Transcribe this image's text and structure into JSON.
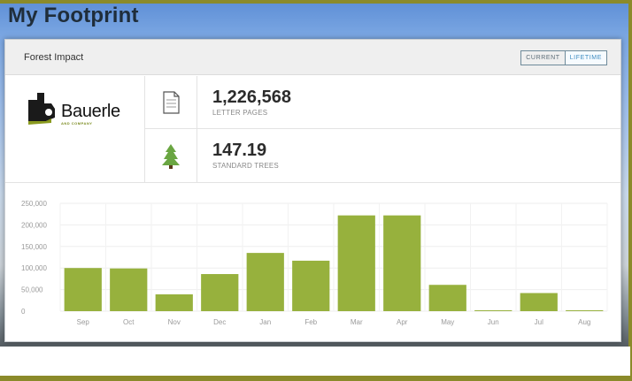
{
  "page": {
    "title": "My Footprint"
  },
  "card": {
    "title": "Forest Impact",
    "toggle": {
      "current_label": "CURRENT",
      "lifetime_label": "LIFETIME",
      "selected": "LIFETIME"
    }
  },
  "brand": {
    "name": "Bauerle",
    "subtitle": "AND COMPANY",
    "mark_color": "#1a1a1a",
    "accent_color": "#8a9a1f"
  },
  "stats": [
    {
      "icon": "document-icon",
      "value": "1,226,568",
      "label": "LETTER PAGES"
    },
    {
      "icon": "tree-icon",
      "value": "147.19",
      "label": "STANDARD TREES"
    }
  ],
  "colors": {
    "bar": "#97b13d",
    "tree": "#6aa642"
  },
  "chart_data": {
    "type": "bar",
    "categories": [
      "Sep",
      "Oct",
      "Nov",
      "Dec",
      "Jan",
      "Feb",
      "Mar",
      "Apr",
      "May",
      "Jun",
      "Jul",
      "Aug"
    ],
    "values": [
      100000,
      99000,
      39000,
      86000,
      135000,
      117000,
      222000,
      222000,
      61000,
      2000,
      42000,
      2000
    ],
    "ylim": [
      0,
      250000
    ],
    "yticks": [
      0,
      50000,
      100000,
      150000,
      200000,
      250000
    ],
    "ytick_labels": [
      "0",
      "50,000",
      "100,000",
      "150,000",
      "200,000",
      "250,000"
    ],
    "grid": true,
    "title": "",
    "xlabel": "",
    "ylabel": ""
  }
}
